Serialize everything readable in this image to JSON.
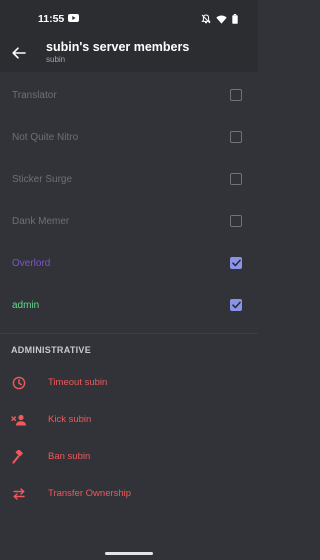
{
  "status_bar": {
    "time": "11:55"
  },
  "header": {
    "title": "subin's server members",
    "subtitle": "subin"
  },
  "roles": [
    {
      "label": "Translator",
      "checked": false
    },
    {
      "label": "Not Quite Nitro",
      "checked": false
    },
    {
      "label": "Sticker Surge",
      "checked": false
    },
    {
      "label": "Dank Memer",
      "checked": false
    },
    {
      "label": "Overlord",
      "checked": true,
      "color": "#7d55c7"
    },
    {
      "label": "admin",
      "checked": true,
      "color": "#62d98a"
    }
  ],
  "administrative": {
    "heading": "ADMINISTRATIVE",
    "actions": [
      {
        "label": "Timeout subin",
        "icon": "clock-icon"
      },
      {
        "label": "Kick subin",
        "icon": "kick-user-icon"
      },
      {
        "label": "Ban subin",
        "icon": "hammer-icon"
      },
      {
        "label": "Transfer Ownership",
        "icon": "transfer-arrows-icon"
      }
    ]
  },
  "colors": {
    "background": "#313338",
    "header_background": "#2b2d31",
    "danger": "#f0595c",
    "checkbox_accent": "#8a93ea"
  }
}
